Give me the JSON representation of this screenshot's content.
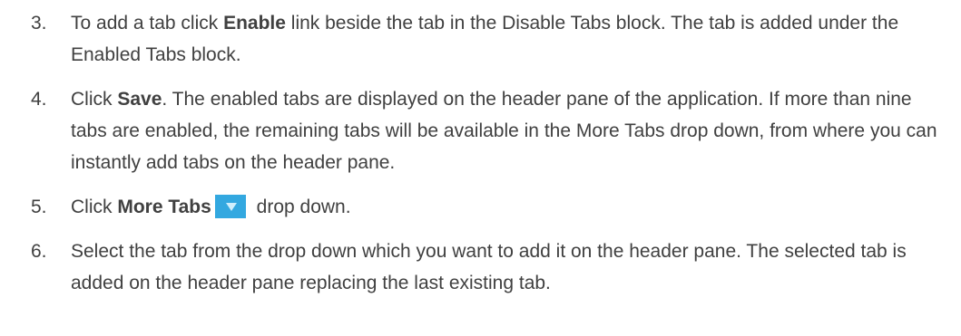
{
  "steps": [
    {
      "number": "3.",
      "text_before": "To add a tab click ",
      "bold": "Enable",
      "text_after": " link beside the tab in the Disable Tabs block. The tab is added under the Enabled Tabs block."
    },
    {
      "number": "4.",
      "text_before": "Click ",
      "bold": "Save",
      "text_after": ". The enabled tabs are displayed on the header pane of the application. If more than nine tabs are enabled, the remaining tabs will be available in the More Tabs drop down, from where you can instantly add tabs on the header pane."
    },
    {
      "number": "5.",
      "text_before": "Click ",
      "bold": "More Tabs",
      "icon": "dropdown-arrow-icon",
      "icon_color": "#33a8e0",
      "text_after": " drop down."
    },
    {
      "number": "6.",
      "text_before": "Select the tab from the drop down which you want to add it on the header pane. The selected tab is added on the header pane replacing the last existing tab."
    }
  ]
}
